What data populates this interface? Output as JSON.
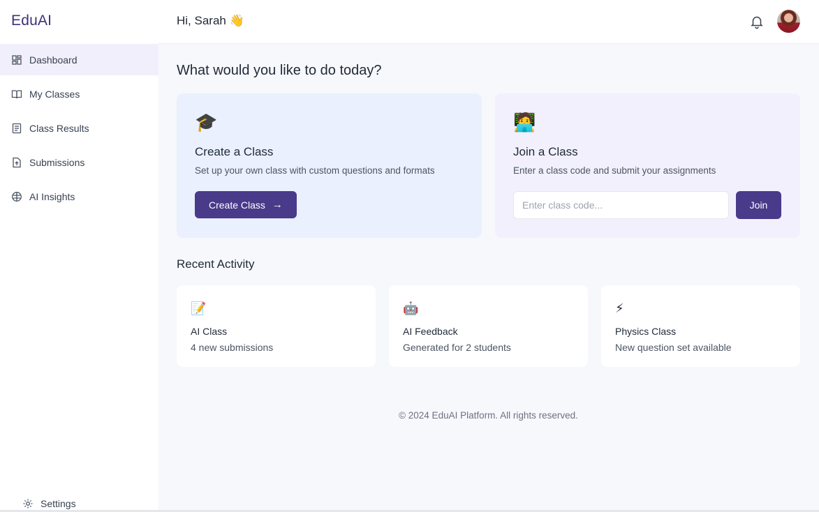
{
  "app": {
    "brand": "EduAI"
  },
  "header": {
    "greeting": "Hi, Sarah 👋"
  },
  "sidebar": {
    "items": [
      {
        "label": "Dashboard",
        "icon": "dashboard-icon",
        "active": true
      },
      {
        "label": "My Classes",
        "icon": "book-icon",
        "active": false
      },
      {
        "label": "Class Results",
        "icon": "document-icon",
        "active": false
      },
      {
        "label": "Submissions",
        "icon": "upload-file-icon",
        "active": false
      },
      {
        "label": "AI Insights",
        "icon": "brain-icon",
        "active": false
      }
    ],
    "settings_label": "Settings"
  },
  "main": {
    "heading": "What would you like to do today?",
    "create": {
      "emoji": "🎓",
      "title": "Create a Class",
      "description": "Set up your own class with custom questions and formats",
      "button_label": "Create Class"
    },
    "join": {
      "emoji": "🧑‍💻",
      "title": "Join a Class",
      "description": "Enter a class code and submit your assignments",
      "input_placeholder": "Enter class code...",
      "input_value": "",
      "button_label": "Join"
    },
    "recent": {
      "title": "Recent Activity",
      "items": [
        {
          "emoji": "📝",
          "title": "AI Class",
          "subtitle": "4 new submissions"
        },
        {
          "emoji": "🤖",
          "title": "AI Feedback",
          "subtitle": "Generated for 2 students"
        },
        {
          "emoji": "⚡",
          "title": "Physics Class",
          "subtitle": "New question set available"
        }
      ]
    }
  },
  "footer": {
    "text": "© 2024 EduAI Platform. All rights reserved."
  },
  "colors": {
    "primary": "#4a3a8a",
    "brand": "#3f3177",
    "active_nav": "#f1effb",
    "create_card": "#eaf0fd",
    "join_card": "#f2f0fc"
  }
}
